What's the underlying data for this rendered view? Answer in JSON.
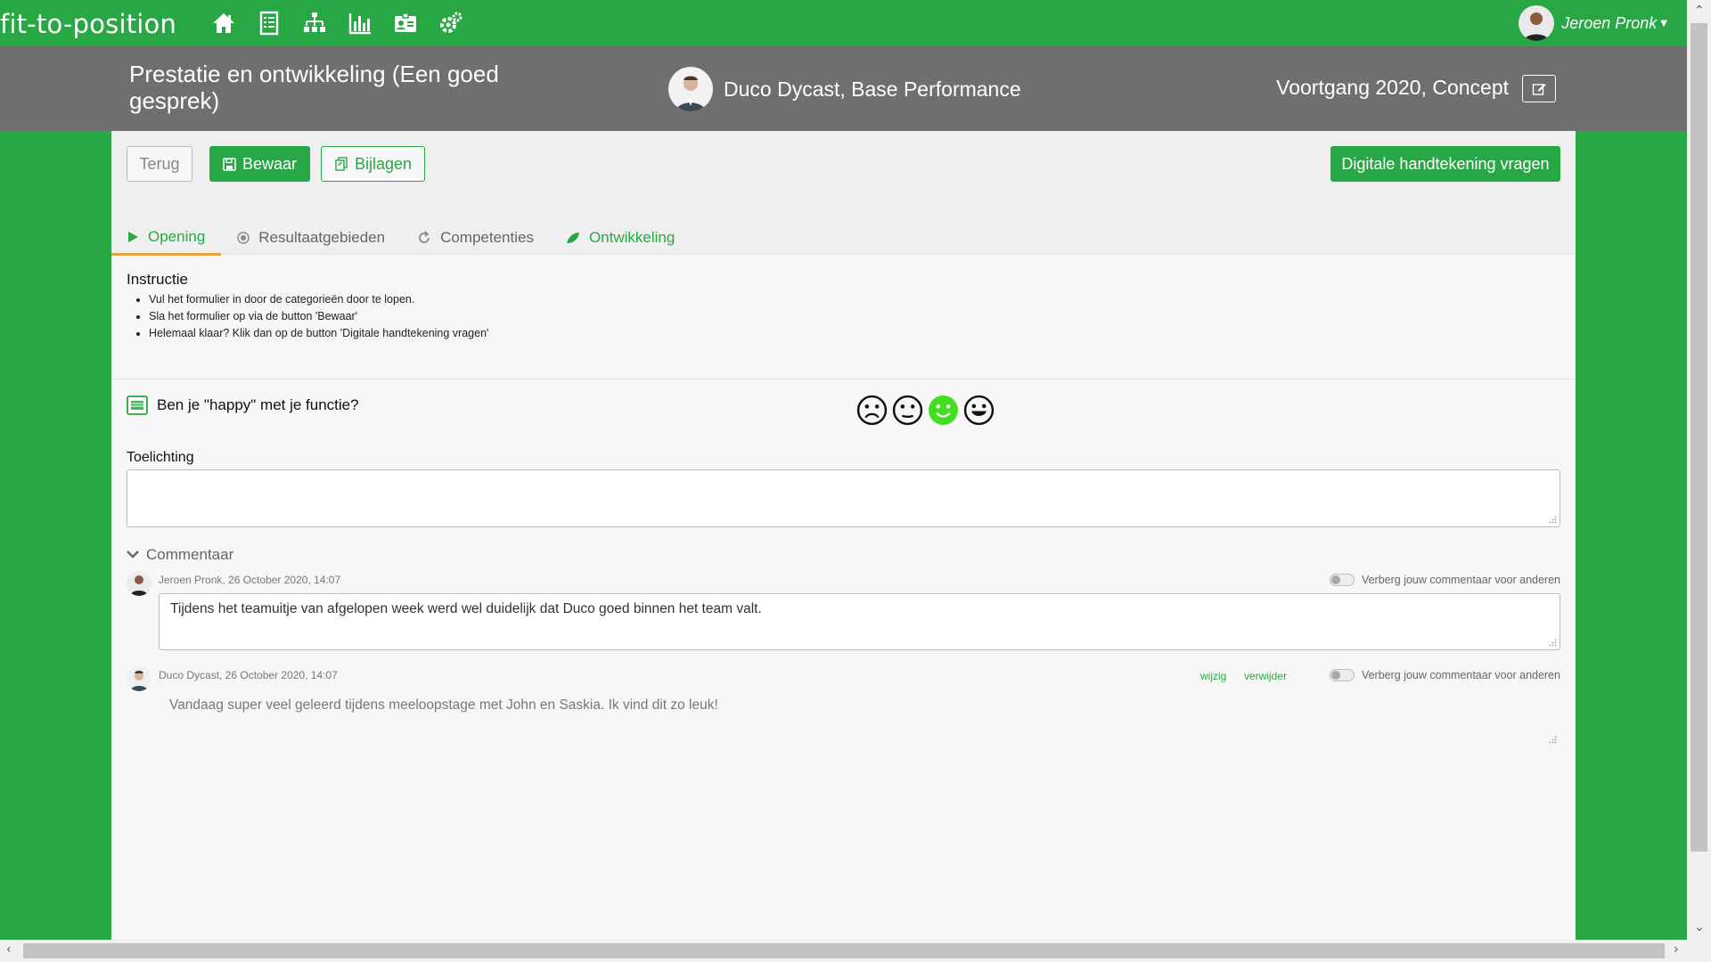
{
  "app": {
    "brand": "fit-to-position",
    "nav_icons": [
      "home-icon",
      "checklist-icon",
      "org-chart-icon",
      "bar-chart-icon",
      "id-card-icon",
      "settings-icon"
    ],
    "user_name": "Jeroen Pronk"
  },
  "header": {
    "title": "Prestatie en ontwikkeling (Een goed gesprek)",
    "employee": "Duco Dycast, Base Performance",
    "status": "Voortgang 2020, Concept"
  },
  "toolbar": {
    "back_label": "Terug",
    "save_label": "Bewaar",
    "attachments_label": "Bijlagen",
    "sign_label": "Digitale handtekening vragen"
  },
  "tabs": [
    {
      "label": "Opening",
      "icon": "play-icon",
      "active": true
    },
    {
      "label": "Resultaatgebieden",
      "icon": "target-icon",
      "active": false
    },
    {
      "label": "Competenties",
      "icon": "refresh-icon",
      "active": false
    },
    {
      "label": "Ontwikkeling",
      "icon": "leaf-icon",
      "active": false
    }
  ],
  "instruction": {
    "title": "Instructie",
    "items": [
      "Vul het formulier in door de categorieën door te lopen.",
      "Sla het formulier op via de button 'Bewaar'",
      "Helemaal klaar? Klik dan op de button 'Digitale handtekening vragen'"
    ]
  },
  "question": {
    "text": "Ben je \"happy\" met je functie?",
    "smileys": [
      "sad",
      "neutral",
      "smile",
      "laugh"
    ],
    "selected_smiley": "smile",
    "explanation_label": "Toelichting",
    "explanation_value": ""
  },
  "comments": {
    "title": "Commentaar",
    "items": [
      {
        "author_meta": "Jeroen Pronk, 26 October 2020, 14:07",
        "text": "Tijdens het teamuitje van afgelopen week werd wel duidelijk dat Duco goed binnen het team valt.",
        "toggle_label": "Verberg jouw commentaar voor anderen"
      },
      {
        "author_meta": "Duco Dycast, 26 October 2020, 14:07",
        "text": "Vandaag super veel geleerd tijdens meeloopstage met John en Saskia. Ik vind dit zo leuk!",
        "edit_label": "wijzig",
        "delete_label": "verwijder",
        "toggle_label": "Verberg jouw commentaar voor anderen"
      }
    ]
  },
  "colors": {
    "brand_green": "#27a844",
    "header_grey": "#6f6f6f",
    "tab_underline": "#e8a33d",
    "selected_smiley": "#44dd22"
  }
}
